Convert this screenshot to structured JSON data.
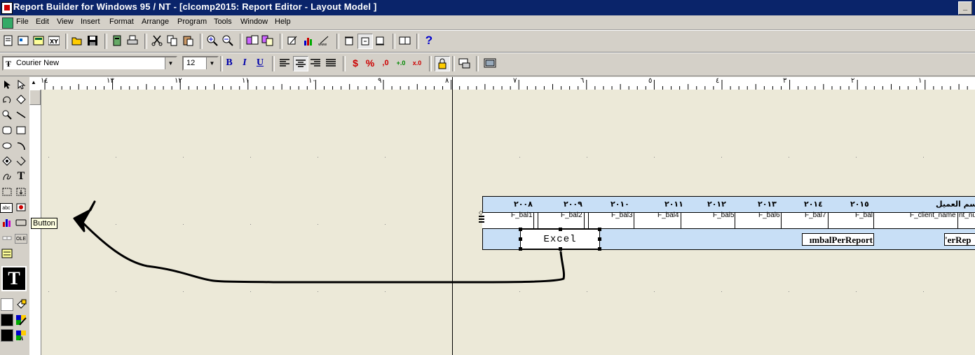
{
  "window": {
    "title": "Report Builder for Windows 95 / NT - [clcomp2015: Report Editor - Layout Model ]",
    "minimize_glyph": "_"
  },
  "menu": [
    "File",
    "Edit",
    "View",
    "Insert",
    "Format",
    "Arrange",
    "Program",
    "Tools",
    "Window",
    "Help"
  ],
  "format_toolbar": {
    "font_name": "Courier New",
    "font_size": "12",
    "bold": "B",
    "italic": "I",
    "underline": "U",
    "currency": "$",
    "percent": "%",
    "comma": ",0",
    "add_decimal": "+.0",
    "remove_decimal": "x.0"
  },
  "help_glyph": "?",
  "ruler": {
    "labels": [
      "١٤",
      "١٣",
      "١٢",
      "١١",
      "١٠",
      "٩",
      "٨",
      "٧",
      "٦",
      "٥",
      "٤",
      "٣",
      "٢",
      "١"
    ]
  },
  "tooltip": "Button",
  "palette": {
    "text_tool": "T",
    "big_text": "T",
    "field_tool": "abc",
    "ole_tool": "OLE"
  },
  "report": {
    "header_labels": [
      "٢٠٠٨",
      "٢٠٠٩",
      "٢٠١٠",
      "٢٠١١",
      "٢٠١٢",
      "٢٠١٣",
      "٢٠١٤",
      "٢٠١٥",
      "واسم العميل"
    ],
    "fields": [
      "F_bal1",
      "F_bal2",
      "F_bal3",
      "F_bal4",
      "F_bal5",
      "F_bal6",
      "F_bal7",
      "F_bal",
      "F_client_name",
      "nt_nu"
    ],
    "button_label": "Excel",
    "summary_1": "ımbalPerReport",
    "summary_2": "'erRep"
  }
}
